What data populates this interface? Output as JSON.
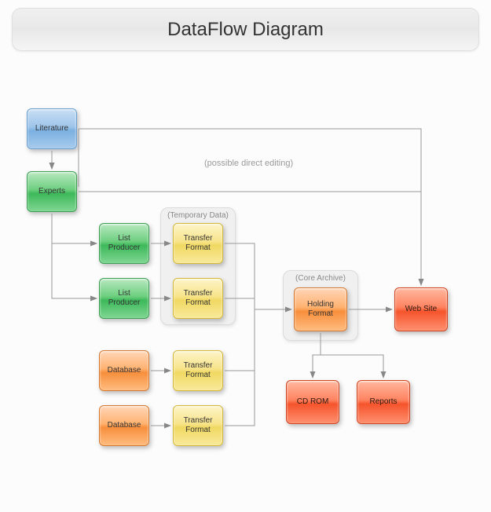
{
  "title": "DataFlow Diagram",
  "annotations": {
    "direct_editing": "(possible direct editing)"
  },
  "groups": {
    "temporary_data": {
      "label": "(Temporary Data)"
    },
    "core_archive": {
      "label": "(Core Archive)"
    }
  },
  "nodes": {
    "literature": "Literature",
    "experts": "Experts",
    "list_producer_1": "List Producer",
    "list_producer_2": "List Producer",
    "transfer_format_1": "Transfer Format",
    "transfer_format_2": "Transfer Format",
    "transfer_format_3": "Transfer Format",
    "transfer_format_4": "Transfer Format",
    "database_1": "Database",
    "database_2": "Database",
    "holding_format": "Holding Format",
    "web_site": "Web Site",
    "cd_rom": "CD ROM",
    "reports": "Reports"
  },
  "colors": {
    "blue": "#7bb0e0",
    "green": "#3db85a",
    "yellow": "#f0d862",
    "orange": "#f78f3c",
    "red": "#f5542c"
  },
  "edges": [
    {
      "from": "literature",
      "to": "experts"
    },
    {
      "from": "experts",
      "to": "list_producer_1"
    },
    {
      "from": "experts",
      "to": "list_producer_2"
    },
    {
      "from": "experts",
      "to": "web_site",
      "note": "possible direct editing"
    },
    {
      "from": "list_producer_1",
      "to": "transfer_format_1"
    },
    {
      "from": "list_producer_2",
      "to": "transfer_format_2"
    },
    {
      "from": "database_1",
      "to": "transfer_format_3"
    },
    {
      "from": "database_2",
      "to": "transfer_format_4"
    },
    {
      "from": "transfer_format_1",
      "to": "holding_format"
    },
    {
      "from": "transfer_format_2",
      "to": "holding_format"
    },
    {
      "from": "transfer_format_3",
      "to": "holding_format"
    },
    {
      "from": "transfer_format_4",
      "to": "holding_format"
    },
    {
      "from": "holding_format",
      "to": "web_site"
    },
    {
      "from": "holding_format",
      "to": "cd_rom"
    },
    {
      "from": "holding_format",
      "to": "reports"
    }
  ]
}
